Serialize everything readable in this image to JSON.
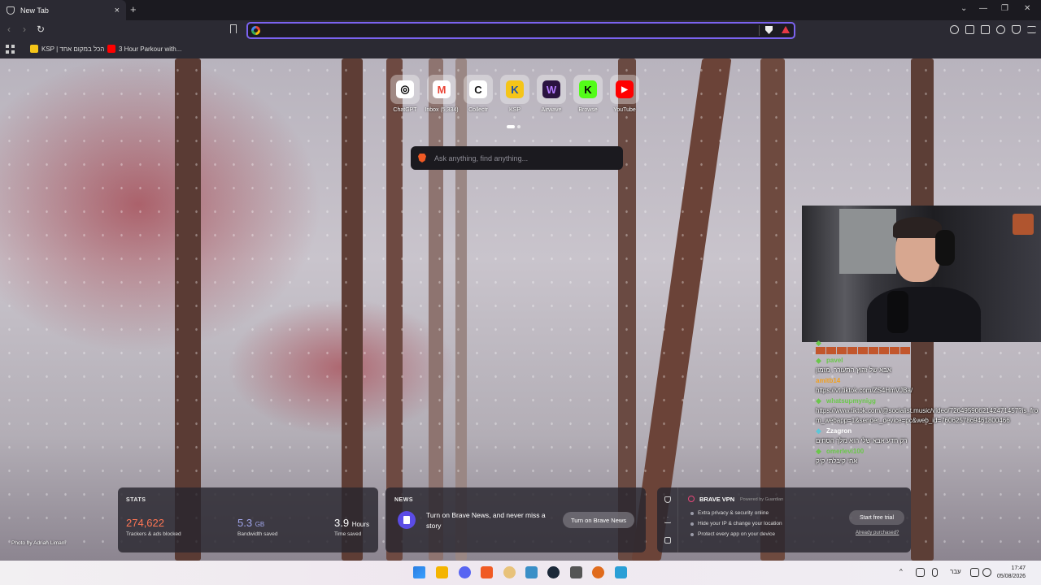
{
  "browser": {
    "tab": {
      "title": "New Tab",
      "close": "×"
    },
    "new_tab": "+",
    "window_controls": {
      "menu": "⌄",
      "minimize": "—",
      "restore": "❐",
      "close": "✕"
    },
    "nav": {
      "back": "‹",
      "forward": "›",
      "reload": "↻"
    },
    "address": {
      "value": ""
    }
  },
  "bookmarks": [
    {
      "label": "KSP | הכל במקום אחד"
    },
    {
      "label": "3 Hour Parkour with..."
    }
  ],
  "top_sites": [
    {
      "label": "ChatGPT",
      "glyph": "◎",
      "color": "#ffffff",
      "fg": "#000000"
    },
    {
      "label": "Inbox (5,334)",
      "glyph": "M",
      "color": "#ffffff",
      "fg": "#ea4335"
    },
    {
      "label": "Collectr",
      "glyph": "C",
      "color": "#ffffff",
      "fg": "#111111"
    },
    {
      "label": "KSP",
      "glyph": "K",
      "color": "#f5c518",
      "fg": "#1d4fa5"
    },
    {
      "label": "Airwave",
      "glyph": "W",
      "color": "#2a1340",
      "fg": "#b47bff"
    },
    {
      "label": "Browse",
      "glyph": "K",
      "color": "#53fc18",
      "fg": "#000000"
    },
    {
      "label": "YouTube",
      "glyph": "▶",
      "color": "#ff0000",
      "fg": "#ffffff"
    }
  ],
  "search": {
    "placeholder": "Ask anything, find anything..."
  },
  "chat": [
    {
      "name": "",
      "name_color": "#e0453a",
      "message": "",
      "emotes": 9
    },
    {
      "name": "pavel",
      "name_color": "#6ac74a",
      "message": "אבא של זהוץ התעורר, מזמון"
    },
    {
      "name": "amitb14",
      "name_color": "#f0a020",
      "message": "https://vt.tiktok.com/ZS4HmVJBa/"
    },
    {
      "name": "whatsupmynigg",
      "name_color": "#6ac74a",
      "message": "https://www.tiktok.com/@socialist.music/video/7264959062142471457?is_from_webapp=1&sender_device=pc&web_id=7606257869461800466"
    },
    {
      "name": "Zzagron",
      "name_color": "#5bc7d8",
      "message": "רק חדע אבא שלי הוא מלך הסחים"
    },
    {
      "name": "omerlevi100",
      "name_color": "#6ac74a",
      "message": "אחי קיבלתי קיק"
    }
  ],
  "stats": {
    "title": "STATS",
    "trackers": {
      "value": "274,622",
      "label": "Trackers & ads blocked",
      "color": "#ff7654"
    },
    "bandwidth": {
      "value": "5.3",
      "unit": "GB",
      "label": "Bandwidth saved",
      "color": "#a0a5eb"
    },
    "time": {
      "value": "3.9",
      "unit": "Hours",
      "label": "Time saved",
      "color": "#ffffff"
    }
  },
  "news": {
    "title": "NEWS",
    "text": "Turn on Brave News, and never miss a story",
    "button": "Turn on Brave News"
  },
  "vpn": {
    "title": "BRAVE VPN",
    "powered": "Powered by Guardian",
    "features": [
      "Extra privacy & security online",
      "Hide your IP & change your location",
      "Protect every app on your device"
    ],
    "button": "Start free trial",
    "link": "Already purchased?"
  },
  "photo_credit": "Photo by Adrian Limani",
  "taskbar": {
    "lang": "עבר",
    "time": "17:47",
    "date": "05/08/2026",
    "tray_arrow": "^"
  }
}
